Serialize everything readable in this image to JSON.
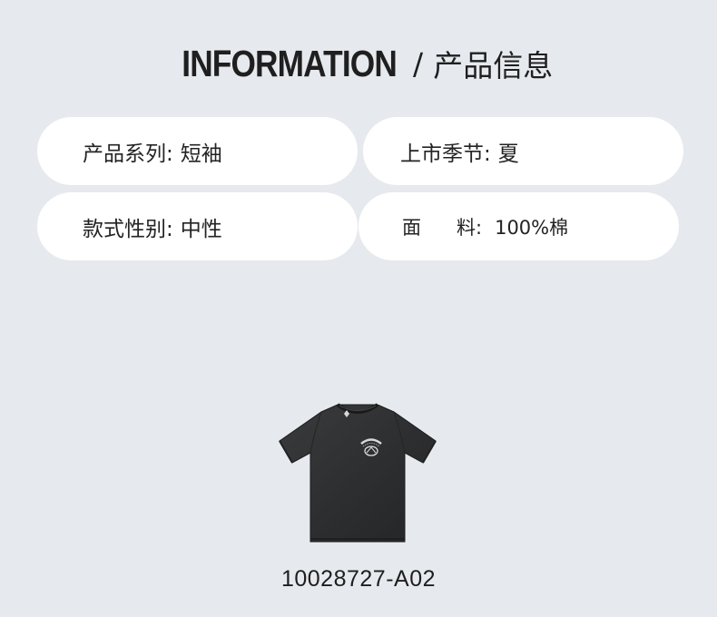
{
  "header": {
    "title_en": "INFORMATION",
    "separator": "/",
    "title_cn": "产品信息"
  },
  "info": [
    {
      "label": "产品系列:",
      "value": "短袖"
    },
    {
      "label": "上市季节:",
      "value": "夏"
    },
    {
      "label": "款式性别:",
      "value": "中性"
    },
    {
      "label_a": "面",
      "label_b": "料:",
      "value": "100%棉"
    }
  ],
  "product": {
    "image_icon": "black-tshirt-image",
    "code": "10028727-A02"
  }
}
